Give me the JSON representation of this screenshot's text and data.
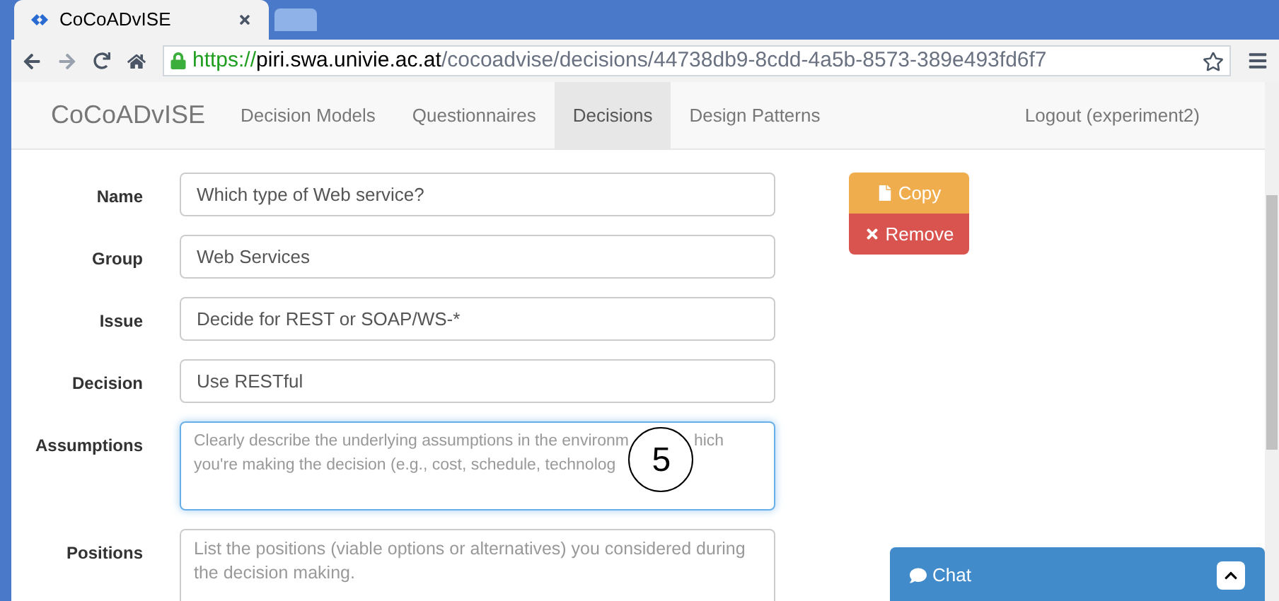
{
  "browser": {
    "tab_title": "CoCoADvISE",
    "url_scheme": "https://",
    "url_host": "piri.swa.univie.ac.at",
    "url_path": "/cocoadvise/decisions/44738db9-8cdd-4a5b-8573-389e493fd6f7"
  },
  "navbar": {
    "brand": "CoCoADvISE",
    "items": [
      {
        "label": "Decision Models",
        "selected": false
      },
      {
        "label": "Questionnaires",
        "selected": false
      },
      {
        "label": "Decisions",
        "selected": true
      },
      {
        "label": "Design Patterns",
        "selected": false
      }
    ],
    "logout": "Logout (experiment2)"
  },
  "fields": [
    {
      "label": "Name",
      "kind": "input",
      "value": "Which type of Web service?"
    },
    {
      "label": "Group",
      "kind": "input",
      "value": "Web Services"
    },
    {
      "label": "Issue",
      "kind": "input",
      "value": "Decide for REST or SOAP/WS-*"
    },
    {
      "label": "Decision",
      "kind": "input",
      "value": "Use RESTful"
    },
    {
      "label": "Assumptions",
      "kind": "textarea",
      "focused": true,
      "placeholder_parts": [
        "Clearly describe the underlying assumptions in the environm",
        "hich",
        "you're making the decision (e.g., cost, schedule, technolog"
      ]
    },
    {
      "label": "Positions",
      "kind": "textarea",
      "focused": false,
      "placeholder_parts": [
        "List the positions (viable options or alternatives) you considered during",
        "the decision making."
      ]
    }
  ],
  "actions": [
    {
      "label": "Copy",
      "kind": "warning"
    },
    {
      "label": "Remove",
      "kind": "danger"
    }
  ],
  "annotation": "5",
  "chat": {
    "label": "Chat"
  }
}
